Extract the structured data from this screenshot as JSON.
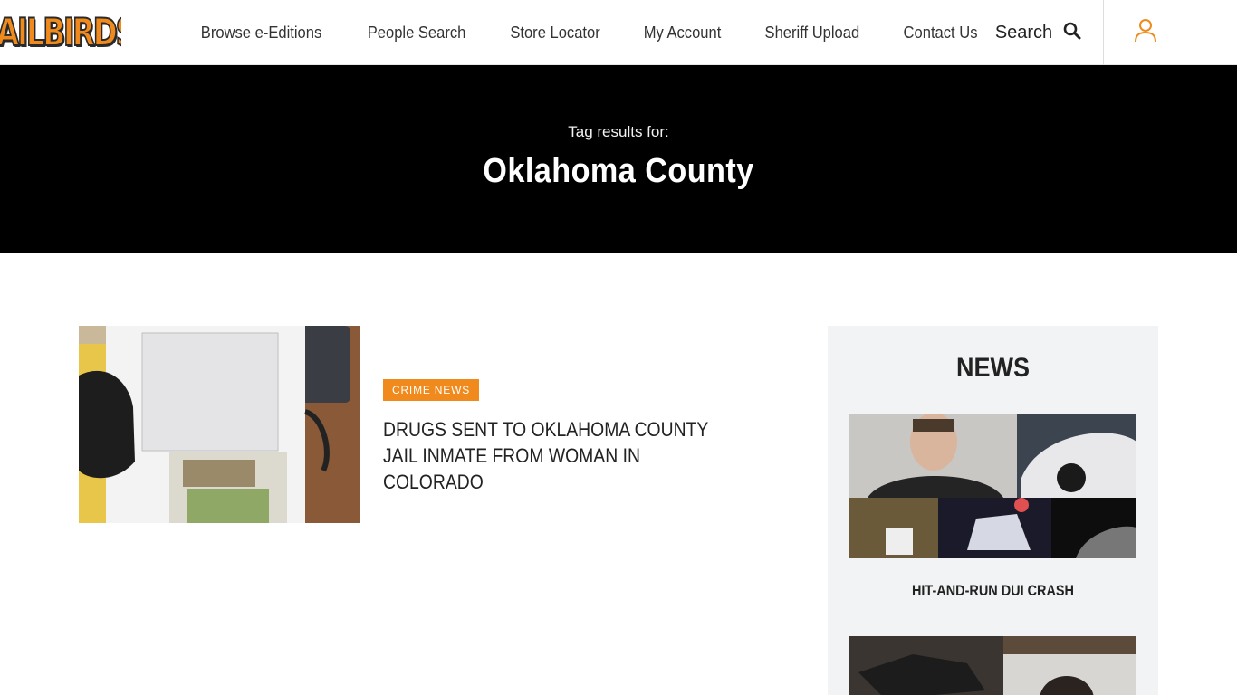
{
  "brand": {
    "logo_text": "JAILBIRDS",
    "accent": "#f08a1c"
  },
  "nav": {
    "items": [
      {
        "label": "Browse e-Editions"
      },
      {
        "label": "People Search"
      },
      {
        "label": "Store Locator"
      },
      {
        "label": "My Account"
      },
      {
        "label": "Sheriff Upload"
      },
      {
        "label": "Contact Us"
      }
    ],
    "search_label": "Search",
    "search_icon": "search-icon",
    "account_icon": "user-icon"
  },
  "hero": {
    "subtitle": "Tag results for:",
    "title": "Oklahoma County"
  },
  "article": {
    "category": "CRIME NEWS",
    "headline": "DRUGS SENT TO OKLAHOMA COUNTY JAIL INMATE FROM WOMAN IN COLORADO"
  },
  "sidebar": {
    "title": "NEWS",
    "items": [
      {
        "caption": "HIT-AND-RUN DUI CRASH"
      }
    ]
  }
}
